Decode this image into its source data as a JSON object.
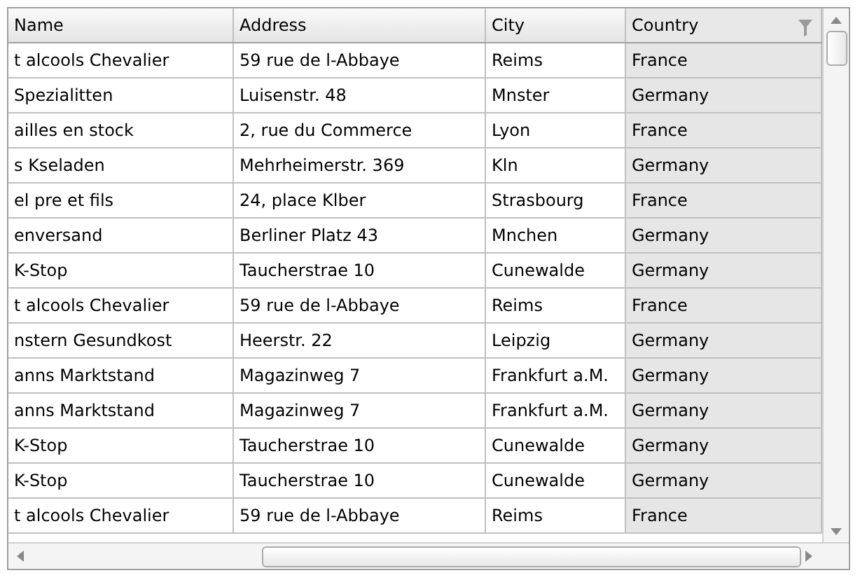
{
  "table": {
    "columns": [
      {
        "label": "Name",
        "filtered": false
      },
      {
        "label": "Address",
        "filtered": false
      },
      {
        "label": "City",
        "filtered": false
      },
      {
        "label": "Country",
        "filtered": true
      }
    ],
    "rows": [
      [
        "t alcools Chevalier",
        "59 rue de l-Abbaye",
        "Reims",
        "France"
      ],
      [
        "Spezialitten",
        "Luisenstr. 48",
        "Mnster",
        "Germany"
      ],
      [
        "ailles en stock",
        "2, rue du Commerce",
        "Lyon",
        "France"
      ],
      [
        "s Kseladen",
        "Mehrheimerstr. 369",
        "Kln",
        "Germany"
      ],
      [
        "el pre et fils",
        "24, place Klber",
        "Strasbourg",
        "France"
      ],
      [
        "enversand",
        "Berliner Platz 43",
        "Mnchen",
        "Germany"
      ],
      [
        "K-Stop",
        "Taucherstrae 10",
        "Cunewalde",
        "Germany"
      ],
      [
        "t alcools Chevalier",
        "59 rue de l-Abbaye",
        "Reims",
        "France"
      ],
      [
        "nstern Gesundkost",
        "Heerstr. 22",
        "Leipzig",
        "Germany"
      ],
      [
        "anns Marktstand",
        "Magazinweg 7",
        "Frankfurt a.M.",
        "Germany"
      ],
      [
        "anns Marktstand",
        "Magazinweg 7",
        "Frankfurt a.M.",
        "Germany"
      ],
      [
        "K-Stop",
        "Taucherstrae 10",
        "Cunewalde",
        "Germany"
      ],
      [
        "K-Stop",
        "Taucherstrae 10",
        "Cunewalde",
        "Germany"
      ],
      [
        "t alcools Chevalier",
        "59 rue de l-Abbaye",
        "Reims",
        "France"
      ]
    ]
  }
}
